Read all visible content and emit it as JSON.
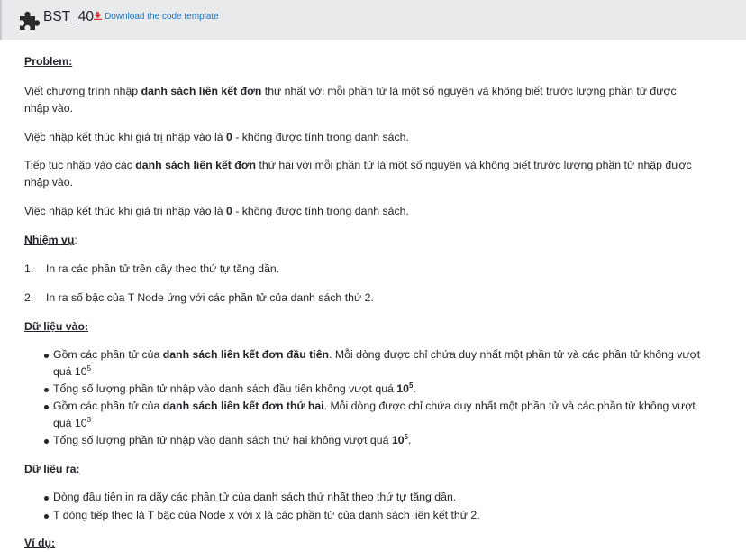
{
  "header": {
    "title": "BST_40",
    "download_label": "Download the code template"
  },
  "problem": {
    "title": "Problem:",
    "p1": [
      "Viết chương trình nhập ",
      "danh sách liên kết đơn",
      " thứ nhất với mỗi phần tử là một số nguyên và không biết trước lượng phần tử được",
      "nhập vào."
    ],
    "p2": [
      "Việc nhập kết thúc khi giá trị nhập vào là ",
      "0",
      " - không được tính trong danh sách."
    ],
    "p3": [
      "Tiếp tục nhập vào các ",
      "danh sách liên kết đơn",
      " thứ hai với mỗi phần tử là một số nguyên và không biết trước lượng phần tử nhập được",
      "nhập vào."
    ],
    "p4": [
      "Việc nhập kết thúc khi giá trị nhập vào là ",
      "0",
      " - không được tính trong danh sách."
    ]
  },
  "tasks": {
    "title": "Nhiệm vụ",
    "colon": ":",
    "items": [
      {
        "num": "1.",
        "text": "In ra các phần tử trên cây theo thứ tự tăng dần."
      },
      {
        "num": "2.",
        "text": "In ra số bậc của T Node ứng với các phần tử của danh sách thứ 2."
      }
    ]
  },
  "input": {
    "title": "Dữ liệu vào:",
    "b1": [
      "Gồm các phần tử của ",
      "danh sách liên kết đơn đầu tiên",
      ". Mỗi dòng được chỉ chứa duy nhất một phần tử và các phần tử không vượt",
      "quá 10",
      "5"
    ],
    "b2": [
      "Tổng số lượng phần tử nhập vào danh sách đầu tiên không vượt quá ",
      "10",
      "5",
      "."
    ],
    "b3": [
      "Gồm các phần tử của ",
      "danh sách liên kết đơn thứ hai",
      ". Mỗi dòng được chỉ chứa duy nhất một phần tử và các phần tử không vượt",
      "quá 10",
      "3"
    ],
    "b4": [
      "Tổng số lượng phần tử nhập vào danh sách thứ hai không vượt quá ",
      "10",
      "5",
      "."
    ]
  },
  "output": {
    "title": "Dữ liệu ra:",
    "b1": "Dòng đầu tiên in ra dãy các phần tử của danh sách thứ nhất theo thứ tự tăng dần.",
    "b2": "T dòng tiếp theo là T bậc của Node x với x là các phần tử của danh sách liên kết thứ 2."
  },
  "example": {
    "title": "Ví dụ:"
  },
  "colors": {
    "link": "#1a73c8",
    "download_icon": "#d9363e",
    "topbar": "#e9eaec"
  }
}
